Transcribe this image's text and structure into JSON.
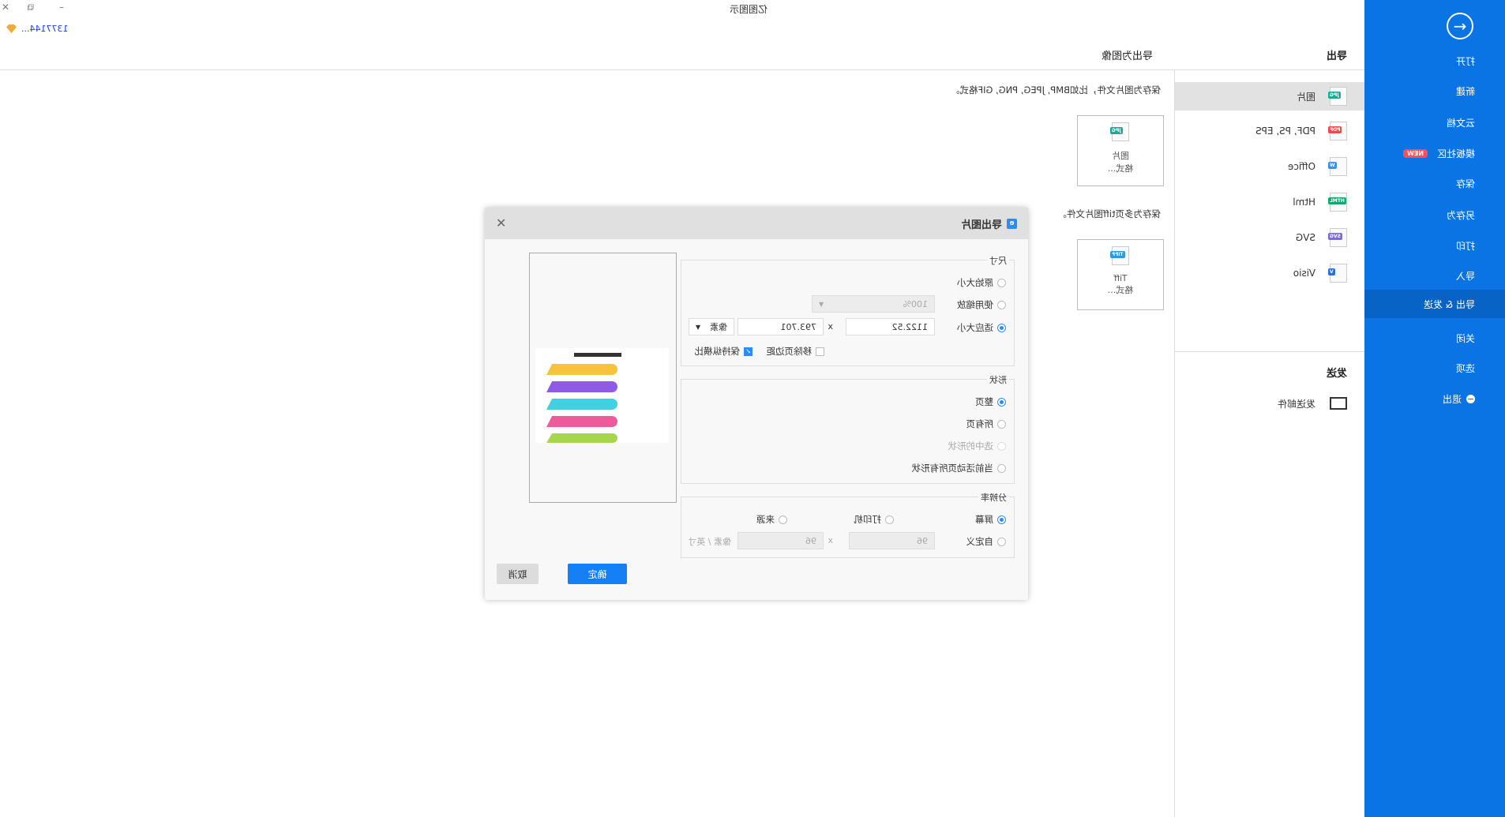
{
  "window": {
    "title": "亿图图示",
    "user": "1377144...",
    "controls": {
      "minimize": "–",
      "restore": "⧉",
      "close": "✕"
    }
  },
  "sidebar": {
    "items": [
      {
        "label": "打开"
      },
      {
        "label": "新建"
      },
      {
        "label": "云文档"
      },
      {
        "label": "模板社区",
        "badge": "NEW"
      },
      {
        "label": "保存"
      },
      {
        "label": "另存为"
      },
      {
        "label": "打印"
      },
      {
        "label": "导入"
      },
      {
        "label": "导出 & 发送",
        "active": true
      },
      {
        "label": "关闭"
      },
      {
        "label": "选项"
      },
      {
        "label": "退出"
      }
    ]
  },
  "export": {
    "heading": "导出",
    "items": [
      {
        "label": "图片",
        "tag": "JPG",
        "color": "#1aa99a",
        "selected": true
      },
      {
        "label": "PDF, PS, EPS",
        "tag": "PDF",
        "color": "#f04b4b"
      },
      {
        "label": "Office",
        "tag": "W",
        "color": "#3c8ff0"
      },
      {
        "label": "Html",
        "tag": "HTML",
        "color": "#17a672"
      },
      {
        "label": "SVG",
        "tag": "SVG",
        "color": "#7b6be0"
      },
      {
        "label": "Visio",
        "tag": "V",
        "color": "#2c6fd6"
      }
    ],
    "send_heading": "发送",
    "send_items": [
      {
        "label": "发送邮件"
      }
    ]
  },
  "content": {
    "title": "导出为图像",
    "desc1": "保存为图片文件，比如BMP, JPEG, PNG, GIF格式。",
    "card1": {
      "tag": "JPG",
      "line1": "图片",
      "line2": "格式..."
    },
    "desc2": "保存为多页tiff图片文件。",
    "card2": {
      "tag": "TIFF",
      "line1": "Tiff",
      "line2": "格式..."
    }
  },
  "dialog": {
    "title": "导出图片",
    "size": {
      "legend": "尺寸",
      "original": "原始大小",
      "zoom": "使用缩放",
      "zoom_value": "100%",
      "fit": "适应大小",
      "width": "1122.52",
      "x": "x",
      "height": "793.701",
      "unit": "像素",
      "remove_margin": "移除页边距",
      "keep_ratio": "保持纵横比",
      "selected": "fit",
      "keep_ratio_checked": true,
      "remove_margin_checked": false
    },
    "shape": {
      "legend": "形状",
      "options": [
        "整页",
        "所有页",
        "选中的形状",
        "当前活动页所有形状"
      ],
      "selected": "整页"
    },
    "resolution": {
      "legend": "分辨率",
      "screen": "屏幕",
      "printer": "打印机",
      "source": "来源",
      "custom": "自定义",
      "dpi_x": "96",
      "x": "x",
      "dpi_y": "96",
      "unit": "像素 / 英寸",
      "selected": "屏幕"
    },
    "ok": "确定",
    "cancel": "取消",
    "colors": {
      "accent": "#1580f5"
    }
  }
}
